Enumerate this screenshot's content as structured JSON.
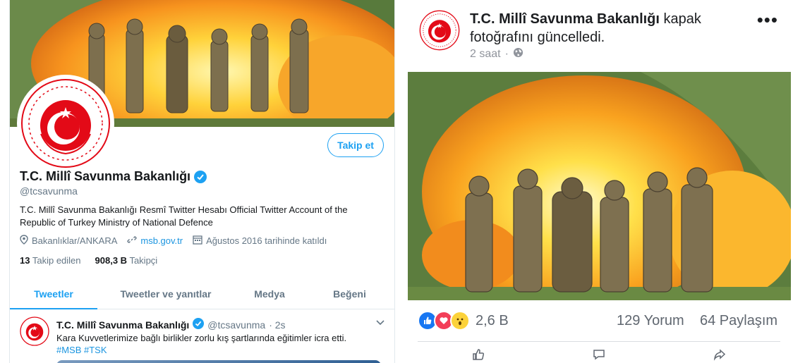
{
  "twitter": {
    "follow_button": "Takip et",
    "name": "T.C. Millî Savunma Bakanlığı",
    "handle": "@tcsavunma",
    "bio": "T.C. Millî Savunma Bakanlığı Resmî Twitter Hesabı Official Twitter Account of the Republic of Turkey Ministry of National Defence",
    "location": "Bakanlıklar/ANKARA",
    "website": "msb.gov.tr",
    "joined": "Ağustos 2016 tarihinde katıldı",
    "stats": {
      "following_count": "13",
      "following_label": "Takip edilen",
      "followers_count": "908,3 B",
      "followers_label": "Takipçi"
    },
    "tabs": [
      {
        "label": "Tweetler",
        "active": true
      },
      {
        "label": "Tweetler ve yanıtlar",
        "active": false
      },
      {
        "label": "Medya",
        "active": false
      },
      {
        "label": "Beğeni",
        "active": false
      }
    ],
    "tweet": {
      "name": "T.C. Millî Savunma Bakanlığı",
      "handle": "@tcsavunma",
      "time": "· 2s",
      "text": "Kara Kuvvetlerimize bağlı birlikler zorlu kış şartlarında eğitimler icra etti.",
      "hashtags": "#MSB #TSK"
    },
    "colors": {
      "accent": "#1da1f2",
      "seal_red": "#e30a17"
    }
  },
  "facebook": {
    "page_name": "T.C. Millî Savunma Bakanlığı",
    "action": "kapak fotoğrafını güncelledi.",
    "time": "2 saat",
    "menu_icon": "more-dots-icon",
    "reactions_count": "2,6 B",
    "comments": "129 Yorum",
    "shares": "64 Paylaşım",
    "reaction_icons": [
      "like-icon",
      "love-icon",
      "wow-icon"
    ]
  }
}
